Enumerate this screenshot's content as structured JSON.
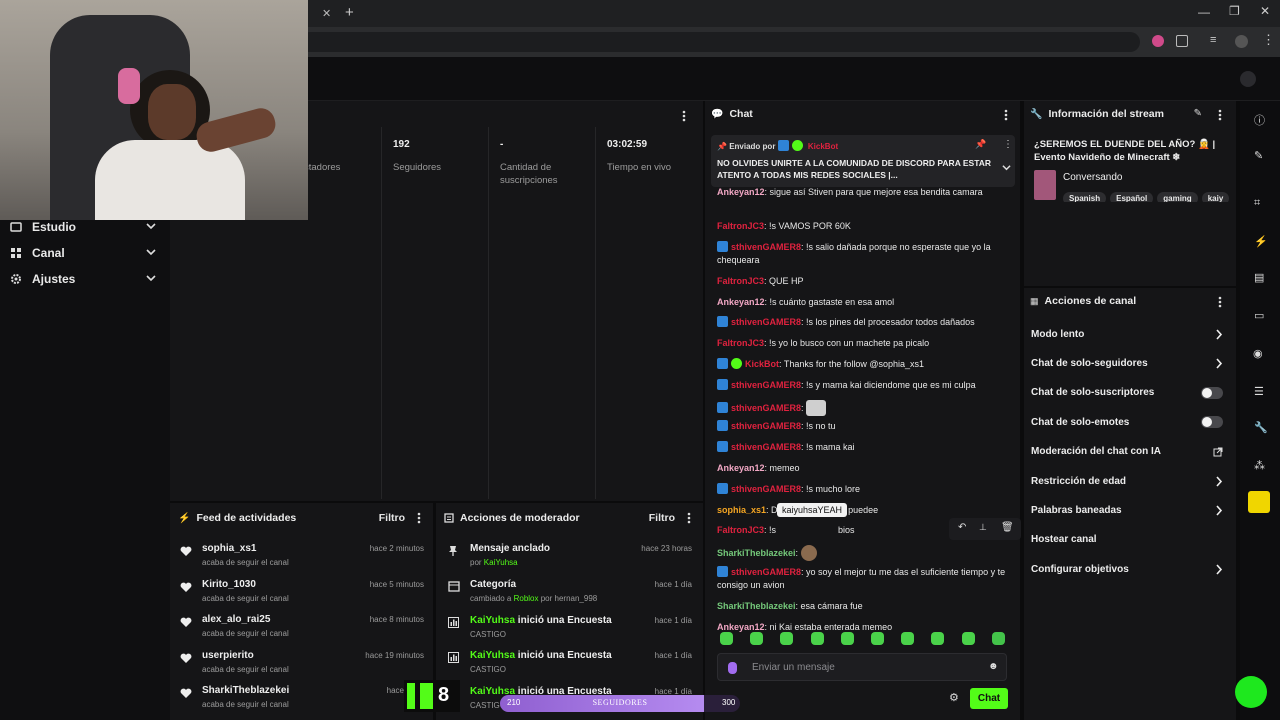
{
  "browser": {
    "new_tab_icon": "plus-icon",
    "close_tab_icon": "close-icon"
  },
  "sidebar": {
    "items": [
      {
        "label": "Estudio",
        "icon": "studio-icon"
      },
      {
        "label": "Canal",
        "icon": "channel-icon"
      },
      {
        "label": "Ajustes",
        "icon": "gear-icon"
      }
    ]
  },
  "stats": {
    "items": [
      {
        "value": "",
        "label": "ctadores"
      },
      {
        "value": "192",
        "label": "Seguidores"
      },
      {
        "value": "-",
        "label": "Cantidad de suscripciones"
      },
      {
        "value": "03:02:59",
        "label": "Tiempo en vivo"
      }
    ]
  },
  "feed": {
    "title": "Feed de actividades",
    "filter": "Filtro",
    "items": [
      {
        "name": "sophia_xs1",
        "sub": "acaba de seguir el canal",
        "time": "hace 2 minutos"
      },
      {
        "name": "Kirito_1030",
        "sub": "acaba de seguir el canal",
        "time": "hace 5 minutos"
      },
      {
        "name": "alex_alo_rai25",
        "sub": "acaba de seguir el canal",
        "time": "hace 8 minutos"
      },
      {
        "name": "userpierito",
        "sub": "acaba de seguir el canal",
        "time": "hace 19 minutos"
      },
      {
        "name": "SharkiTheblazekei",
        "sub": "acaba de seguir el canal",
        "time": "hace 20 m"
      }
    ]
  },
  "mod": {
    "title": "Acciones de moderador",
    "filter": "Filtro",
    "items": [
      {
        "title": "Mensaje anclado",
        "sub_pre": "por ",
        "sub_hl": "KaiYuhsa",
        "sub_rest": "",
        "time": "hace 23 horas",
        "icon": "pin-icon"
      },
      {
        "title": "Categoría",
        "sub_pre": "cambiado a ",
        "sub_hl": "Roblox",
        "sub_rest": " por hernan_998",
        "time": "hace 1 día",
        "icon": "category-icon"
      },
      {
        "title_hl": "KaiYuhsa",
        "title": " inició una Encuesta",
        "sub_pre": "CASTIGO",
        "time": "hace 1 día",
        "icon": "poll-icon"
      },
      {
        "title_hl": "KaiYuhsa",
        "title": " inició una Encuesta",
        "sub_pre": "CASTIGO",
        "time": "hace 1 día",
        "icon": "poll-icon"
      },
      {
        "title_hl": "KaiYuhsa",
        "title": " inició una Encuesta",
        "sub_pre": "CASTIGO",
        "time": "hace 1 día",
        "icon": "poll-icon"
      }
    ]
  },
  "chat": {
    "title": "Chat",
    "pinned": {
      "sent_by": "Enviado por",
      "author": "KickBot",
      "text": "NO OLVIDES UNIRTE A LA COMUNIDAD DE DISCORD PARA ESTAR ATENTO A TODAS MIS REDES SOCIALES |..."
    },
    "messages": [
      {
        "user": "Ankeyan12",
        "color": "#f2a8c5",
        "text": ": sigue así Stiven para que mejore esa bendita camara",
        "badge": ""
      },
      {
        "user": "FaltronJC3",
        "color": "#e0223f",
        "text": ": !s VAMOS POR 60K",
        "badge": ""
      },
      {
        "user": "sthivenGAMER8",
        "color": "#e0223f",
        "text": ": !s salio dañada porque no esperaste que yo la chequeara",
        "badge": "blue"
      },
      {
        "user": "FaltronJC3",
        "color": "#e0223f",
        "text": ": QUE HP",
        "badge": ""
      },
      {
        "user": "Ankeyan12",
        "color": "#f2a8c5",
        "text": ": !s cuánto gastaste en esa amol",
        "badge": ""
      },
      {
        "user": "sthivenGAMER8",
        "color": "#e0223f",
        "text": ": !s los pines del procesador todos dañados",
        "badge": "blue"
      },
      {
        "user": "FaltronJC3",
        "color": "#e0223f",
        "text": ": !s yo lo busco con un machete pa picalo",
        "badge": ""
      },
      {
        "user": "KickBot",
        "color": "#e0223f",
        "text": ": Thanks for the follow @sophia_xs1",
        "badge": "both"
      },
      {
        "user": "sthivenGAMER8",
        "color": "#e0223f",
        "text": ": !s y mama kai diciendome que es mi culpa",
        "badge": "blue"
      },
      {
        "user": "sthivenGAMER8",
        "color": "#e0223f",
        "text": ": ",
        "badge": "blue",
        "emote": true
      },
      {
        "user": "sthivenGAMER8",
        "color": "#e0223f",
        "text": ": !s no tu",
        "badge": "blue"
      },
      {
        "user": "sthivenGAMER8",
        "color": "#e0223f",
        "text": ": !s mama kai",
        "badge": "blue"
      },
      {
        "user": "Ankeyan12",
        "color": "#f2a8c5",
        "text": ": memeo",
        "badge": ""
      },
      {
        "user": "sthivenGAMER8",
        "color": "#e0223f",
        "text": ": !s mucho lore",
        "badge": "blue"
      },
      {
        "user": "sophia_xs1",
        "color": "#f5a623",
        "text": ": Dale bebaa q si se puedee",
        "badge": ""
      },
      {
        "user": "FaltronJC3",
        "color": "#e0223f",
        "text": ": !s",
        "badge": "",
        "tail": "bios"
      },
      {
        "user": "SharkiTheblazekei",
        "color": "#74c87a",
        "text": ": ",
        "badge": "",
        "emote_sm": true
      },
      {
        "user": "sthivenGAMER8",
        "color": "#e0223f",
        "text": ": yo soy el mejor tu me das el suficiente tiempo y te consigo un avion",
        "badge": "blue"
      },
      {
        "user": "SharkiTheblazekei",
        "color": "#74c87a",
        "text": ": esa cámara fue",
        "badge": ""
      },
      {
        "user": "Ankeyan12",
        "color": "#f2a8c5",
        "text": ": ni Kai estaba enterada memeo",
        "badge": ""
      }
    ],
    "tooltip": "kaiyuhsaYEAH",
    "input_placeholder": "Enviar un mensaje",
    "send_label": "Chat"
  },
  "info": {
    "title": "Información del stream",
    "stream_title": "¿SEREMOS EL DUENDE DEL AÑO? 🧝 | Evento Navideño de Minecraft ❄",
    "category": "Conversando",
    "tags": [
      "Spanish",
      "Español",
      "gaming",
      "kaiy"
    ]
  },
  "actions": {
    "title": "Acciones de canal",
    "items": [
      {
        "label": "Modo lento",
        "control": "chevron"
      },
      {
        "label": "Chat de solo-seguidores",
        "control": "chevron"
      },
      {
        "label": "Chat de solo-suscriptores",
        "control": "toggle"
      },
      {
        "label": "Chat de solo-emotes",
        "control": "toggle"
      },
      {
        "label": "Moderación del chat con IA",
        "control": "external"
      },
      {
        "label": "Restricción de edad",
        "control": "chevron"
      },
      {
        "label": "Palabras baneadas",
        "control": "chevron"
      },
      {
        "label": "Hostear canal",
        "control": "none"
      },
      {
        "label": "Configurar objetivos",
        "control": "chevron"
      }
    ]
  },
  "overlay": {
    "goal_label": "SEGUIDORES",
    "goal_min": "210",
    "goal_max": "300",
    "goal_fraction": 0.85,
    "kick_count": "8",
    "colors": {
      "kick_green": "#53fc18",
      "accent_purple": "#a97be8"
    }
  }
}
